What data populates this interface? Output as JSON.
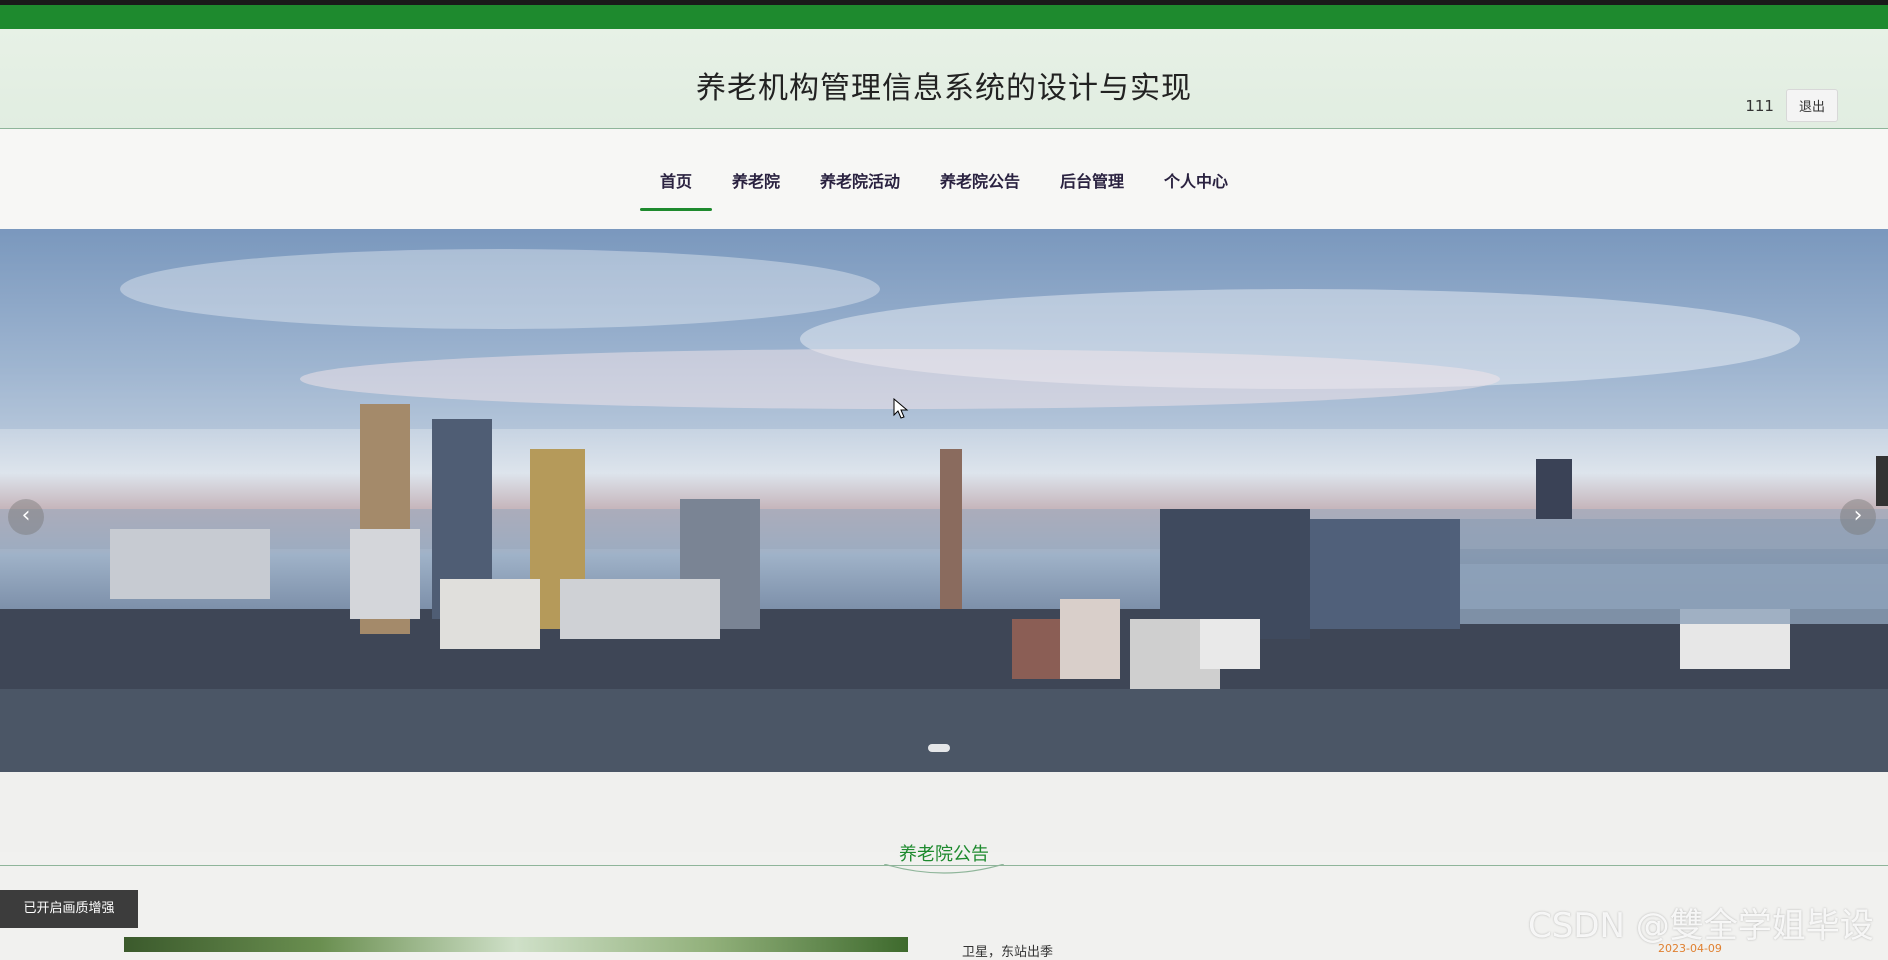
{
  "header": {
    "title": "养老机构管理信息系统的设计与实现",
    "username": "111",
    "logout_label": "退出"
  },
  "nav": {
    "items": [
      {
        "label": "首页",
        "active": true
      },
      {
        "label": "养老院",
        "active": false
      },
      {
        "label": "养老院活动",
        "active": false
      },
      {
        "label": "养老院公告",
        "active": false
      },
      {
        "label": "后台管理",
        "active": false
      },
      {
        "label": "个人中心",
        "active": false
      }
    ]
  },
  "banner": {
    "prev_icon": "‹",
    "next_icon": "›",
    "slide_count": 1
  },
  "notice": {
    "section_title": "养老院公告",
    "first_item_title": "卫星，东站出季",
    "first_item_date": "2023-04-09"
  },
  "overlay": {
    "enhance_label": "已开启画质增强",
    "watermark": "CSDN @雙全学姐毕设"
  },
  "colors": {
    "accent": "#1e8a2e",
    "nav_text": "#2a2240",
    "date_text": "#e08030"
  }
}
